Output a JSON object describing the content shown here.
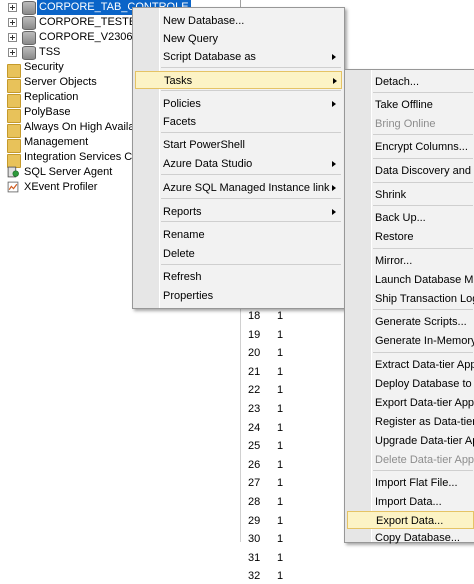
{
  "tree": {
    "databases": [
      {
        "label": "CORPORE_TAB_CONTROLE",
        "selected": true
      },
      {
        "label": "CORPORE_TESTE"
      },
      {
        "label": "CORPORE_V2306"
      },
      {
        "label": "TSS"
      }
    ],
    "folders": [
      "Security",
      "Server Objects",
      "Replication",
      "PolyBase",
      "Always On High Availabili",
      "Management",
      "Integration Services Cata"
    ],
    "sql_server_agent": "SQL Server Agent",
    "xevent_profiler": "XEvent Profiler"
  },
  "context_menu": {
    "items": [
      {
        "label": "New Database..."
      },
      {
        "label": "New Query"
      },
      {
        "label": "Script Database as",
        "submenu": true
      },
      {
        "label": "Tasks",
        "submenu": true,
        "highlighted": true
      },
      {
        "label": "Policies",
        "submenu": true
      },
      {
        "label": "Facets"
      },
      {
        "label": "Start PowerShell"
      },
      {
        "label": "Azure Data Studio",
        "submenu": true
      },
      {
        "label": "Azure SQL Managed Instance link",
        "submenu": true
      },
      {
        "label": "Reports",
        "submenu": true
      },
      {
        "label": "Rename"
      },
      {
        "label": "Delete"
      },
      {
        "label": "Refresh"
      },
      {
        "label": "Properties"
      }
    ]
  },
  "tasks_menu": {
    "items": [
      {
        "label": "Detach..."
      },
      {
        "label": "Take Offline"
      },
      {
        "label": "Bring Online",
        "disabled": true
      },
      {
        "label": "Encrypt Columns..."
      },
      {
        "label": "Data Discovery and Cla"
      },
      {
        "label": "Shrink"
      },
      {
        "label": "Back Up..."
      },
      {
        "label": "Restore"
      },
      {
        "label": "Mirror..."
      },
      {
        "label": "Launch Database Mirro"
      },
      {
        "label": "Ship Transaction Logs..."
      },
      {
        "label": "Generate Scripts..."
      },
      {
        "label": "Generate In-Memory O"
      },
      {
        "label": "Extract Data-tier Applic"
      },
      {
        "label": "Deploy Database to Mi"
      },
      {
        "label": "Export Data-tier Applic"
      },
      {
        "label": "Register as Data-tier Ap"
      },
      {
        "label": "Upgrade Data-tier Appl"
      },
      {
        "label": "Delete Data-tier Applic",
        "disabled": true
      },
      {
        "label": "Import Flat File..."
      },
      {
        "label": "Import Data..."
      },
      {
        "label": "Export Data...",
        "highlighted": true
      },
      {
        "label": "Copy Database..."
      }
    ]
  },
  "results_grid": {
    "rows": [
      {
        "num": "18",
        "val": "1"
      },
      {
        "num": "19",
        "val": "1"
      },
      {
        "num": "20",
        "val": "1"
      },
      {
        "num": "21",
        "val": "1"
      },
      {
        "num": "22",
        "val": "1"
      },
      {
        "num": "23",
        "val": "1"
      },
      {
        "num": "24",
        "val": "1"
      },
      {
        "num": "25",
        "val": "1"
      },
      {
        "num": "26",
        "val": "1"
      },
      {
        "num": "27",
        "val": "1"
      },
      {
        "num": "28",
        "val": "1"
      },
      {
        "num": "29",
        "val": "1"
      },
      {
        "num": "30",
        "val": "1"
      },
      {
        "num": "31",
        "val": "1"
      },
      {
        "num": "32",
        "val": "1"
      }
    ]
  },
  "colors": {
    "selection": "#0a64c8",
    "menu_highlight": "#fcf3c5",
    "menu_highlight_border": "#e5c365",
    "folder": "#e8c25a"
  }
}
